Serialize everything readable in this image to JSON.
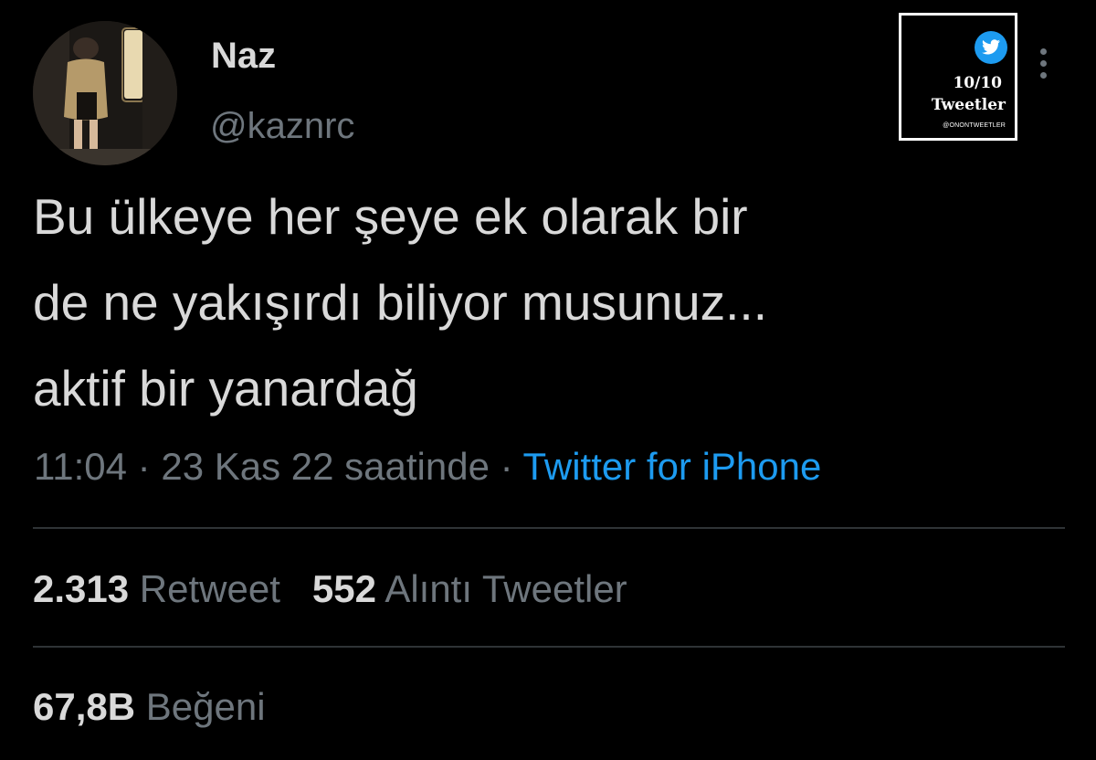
{
  "tweet": {
    "display_name": "Naz",
    "handle": "@kaznrc",
    "lines": [
      "Bu ülkeye her şeye ek olarak bir",
      "de ne yakışırdı biliyor musunuz...",
      "aktif bir yanardağ"
    ],
    "time": "11:04",
    "separator": "·",
    "date": "23 Kas 22 saatinde",
    "source": "Twitter for iPhone"
  },
  "stats": {
    "retweets": {
      "value": "2.313",
      "label": "Retweet"
    },
    "quotes": {
      "value": "552",
      "label": "Alıntı Tweetler"
    },
    "likes": {
      "value": "67,8B",
      "label": "Beğeni"
    }
  },
  "watermark": {
    "score": "10/10",
    "name": "Tweetler",
    "handle": "@ONONTWEETLER",
    "icon": "twitter-bird-icon"
  },
  "icons": {
    "more": "more-vertical-icon"
  },
  "colors": {
    "background": "#000000",
    "text": "#d9d9d9",
    "muted": "#6e767d",
    "link": "#1d9bf0",
    "divider": "#2f3336"
  }
}
